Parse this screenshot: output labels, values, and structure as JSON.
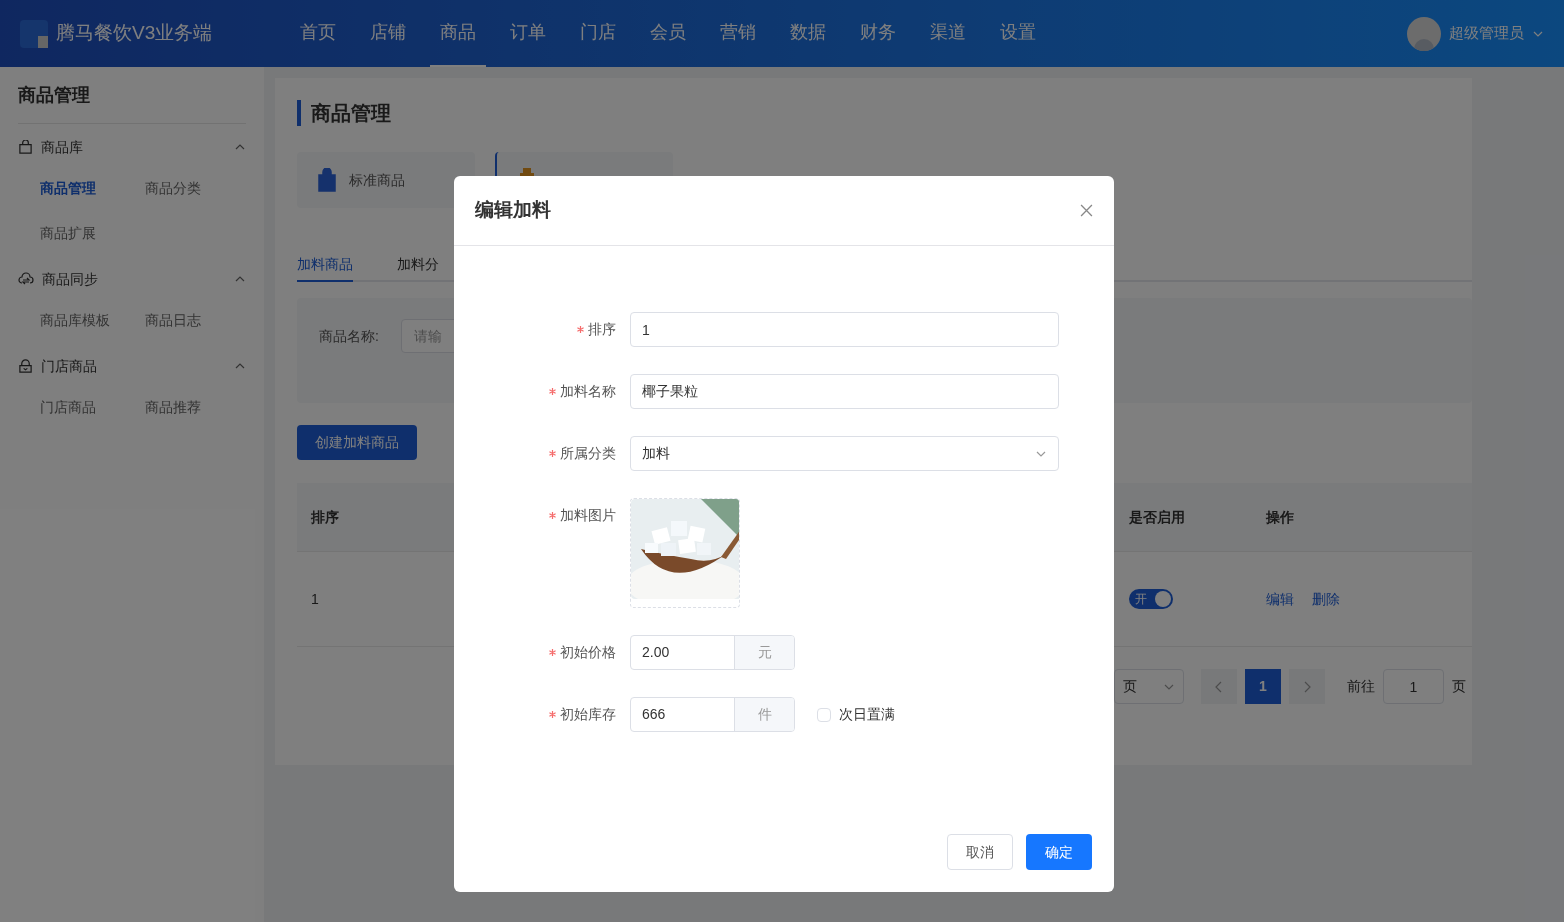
{
  "header": {
    "brand": "腾马餐饮V3业务端",
    "nav": [
      {
        "label": "首页",
        "selected": false
      },
      {
        "label": "店铺",
        "selected": false
      },
      {
        "label": "商品",
        "selected": true
      },
      {
        "label": "订单",
        "selected": false
      },
      {
        "label": "门店",
        "selected": false
      },
      {
        "label": "会员",
        "selected": false
      },
      {
        "label": "营销",
        "selected": false
      },
      {
        "label": "数据",
        "selected": false
      },
      {
        "label": "财务",
        "selected": false
      },
      {
        "label": "渠道",
        "selected": false
      },
      {
        "label": "设置",
        "selected": false
      }
    ],
    "user": "超级管理员"
  },
  "sidebar": {
    "title": "商品管理",
    "groups": [
      {
        "label": "商品库",
        "expanded": true,
        "items": [
          {
            "label": "商品管理",
            "selected": true
          },
          {
            "label": "商品分类",
            "selected": false
          },
          {
            "label": "商品扩展",
            "selected": false
          }
        ]
      },
      {
        "label": "商品同步",
        "expanded": true,
        "items": [
          {
            "label": "商品库模板",
            "selected": false
          },
          {
            "label": "商品日志",
            "selected": false
          }
        ]
      },
      {
        "label": "门店商品",
        "expanded": true,
        "items": [
          {
            "label": "门店商品",
            "selected": false
          },
          {
            "label": "商品推荐",
            "selected": false
          }
        ]
      }
    ]
  },
  "page": {
    "title": "商品管理",
    "type_cards": [
      {
        "label": "标准商品",
        "selected": false
      },
      {
        "selected": true
      }
    ],
    "tabs": [
      {
        "label": "加料商品",
        "selected": true
      },
      {
        "label": "加料分",
        "selected": false
      }
    ],
    "filter": {
      "label": "商品名称:",
      "placeholder": "请输"
    },
    "create_button": "创建加料商品",
    "table": {
      "columns": [
        "排序",
        "是否启用",
        "操作"
      ],
      "rows": [
        {
          "cells": [
            "1"
          ],
          "enabled": true,
          "switch_text": "开",
          "actions": [
            "编辑",
            "删除"
          ]
        }
      ]
    },
    "pagination": {
      "size_select": "页",
      "pages": [
        {
          "label": "1",
          "selected": true
        }
      ],
      "goto_label": "前往",
      "goto_value": "1",
      "goto_suffix": "页"
    }
  },
  "dialog": {
    "title": "编辑加料",
    "fields": [
      {
        "kind": "input",
        "label": "排序",
        "required": true,
        "value": "1"
      },
      {
        "kind": "input",
        "label": "加料名称",
        "required": true,
        "value": "椰子果粒"
      },
      {
        "kind": "select",
        "label": "所属分类",
        "required": true,
        "value": "加料"
      },
      {
        "label": "加料图片",
        "required": true
      },
      {
        "kind": "unit",
        "label": "初始价格",
        "required": true,
        "value": "2.00",
        "unit": "元"
      },
      {
        "kind": "unit",
        "label": "初始库存",
        "required": true,
        "value": "666",
        "unit": "件",
        "checkbox": {
          "label": "次日置满",
          "checked": false
        }
      }
    ],
    "buttons": [
      {
        "label": "取消",
        "kind": "default"
      },
      {
        "label": "确定",
        "kind": "primary"
      }
    ]
  }
}
